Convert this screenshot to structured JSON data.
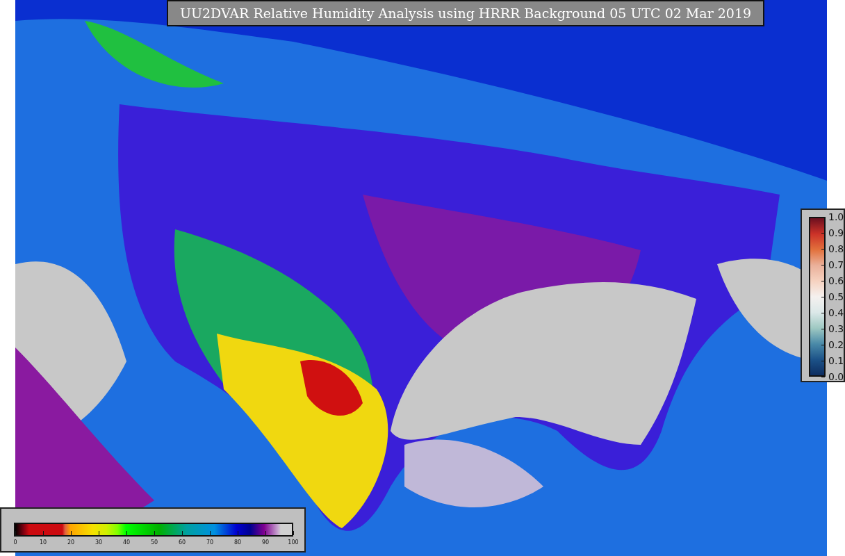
{
  "title": "UU2DVAR Relative Humidity Analysis using HRRR Background 05 UTC 02 Mar 2019",
  "observation_legend": {
    "ticks": [
      "1.0",
      "0.9",
      "0.8",
      "0.7",
      "0.6",
      "0.5",
      "0.4",
      "0.3",
      "0.2",
      "0.1",
      "0.0"
    ]
  },
  "humidity_legend": {
    "ticks": [
      "0",
      "10",
      "20",
      "30",
      "40",
      "50",
      "60",
      "70",
      "80",
      "90",
      "100"
    ]
  }
}
